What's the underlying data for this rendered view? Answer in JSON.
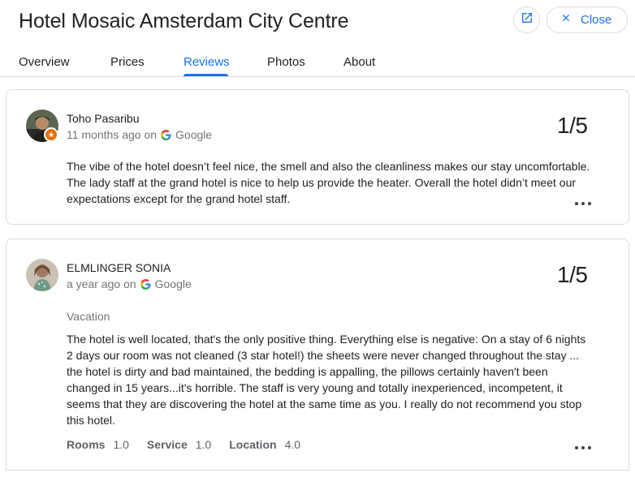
{
  "header": {
    "title": "Hotel Mosaic Amsterdam City Centre",
    "close_label": "Close",
    "open_icon": "open-in-new-icon",
    "close_icon": "close-icon"
  },
  "tabs": [
    {
      "label": "Overview",
      "active": false
    },
    {
      "label": "Prices",
      "active": false
    },
    {
      "label": "Reviews",
      "active": true
    },
    {
      "label": "Photos",
      "active": false
    },
    {
      "label": "About",
      "active": false
    }
  ],
  "reviews": [
    {
      "name": "Toho Pasaribu",
      "time": "11 months ago on",
      "source": "Google",
      "rating": "1/5",
      "text": "The vibe of the hotel doesn’t feel nice, the smell and also the cleanliness makes our stay uncomfortable. The lady staff at the grand hotel is nice to help us provide the heater. Overall the hotel didn’t meet our expectations except for the grand hotel staff.",
      "local_guide_badge": true
    },
    {
      "name": "ELMLINGER SONIA",
      "time": "a year ago on",
      "source": "Google",
      "rating": "1/5",
      "trip_type": "Vacation",
      "text": "The hotel is well located, that's the only positive thing. Everything else is negative: On a stay of 6 nights 2 days our room was not cleaned (3 star hotel!) the sheets were never changed throughout the stay ... the hotel is dirty and bad maintained, the bedding is appalling, the pillows certainly haven't been changed in 15 years...it's horrible. The staff is very young and totally inexperienced, incompetent, it seems that they are discovering the hotel at the same time as you. I really do not recommend you stop this hotel.",
      "sub_ratings": [
        {
          "label": "Rooms",
          "value": "1.0"
        },
        {
          "label": "Service",
          "value": "1.0"
        },
        {
          "label": "Location",
          "value": "4.0"
        }
      ]
    }
  ],
  "colors": {
    "accent": "#1a73e8",
    "badge": "#e8710a",
    "border": "#dadce0",
    "muted_text": "#70757a"
  }
}
